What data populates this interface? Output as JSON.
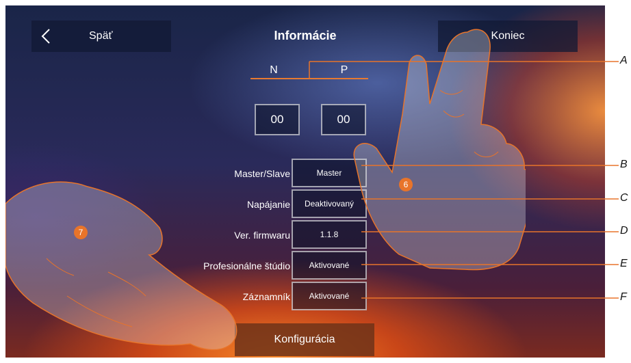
{
  "header": {
    "back_label": "Späť",
    "title": "Informácie",
    "end_label": "Koniec"
  },
  "address": {
    "n_label": "N",
    "p_label": "P",
    "n_value": "00",
    "p_value": "00"
  },
  "rows": [
    {
      "label": "Master/Slave",
      "value": "Master"
    },
    {
      "label": "Napájanie",
      "value": "Deaktivovaný"
    },
    {
      "label": "Ver. firmwaru",
      "value": "1.1.8"
    },
    {
      "label": "Profesionálne štúdio",
      "value": "Aktivované"
    },
    {
      "label": "Záznamník",
      "value": "Aktivované"
    }
  ],
  "config_label": "Konfigurácia",
  "markers": [
    "6",
    "7"
  ],
  "callouts": [
    "A",
    "B",
    "C",
    "D",
    "E",
    "F"
  ],
  "colors": {
    "accent": "#e8742a",
    "panel": "#121a34"
  },
  "icons": {
    "back": "chevron-left-icon"
  }
}
